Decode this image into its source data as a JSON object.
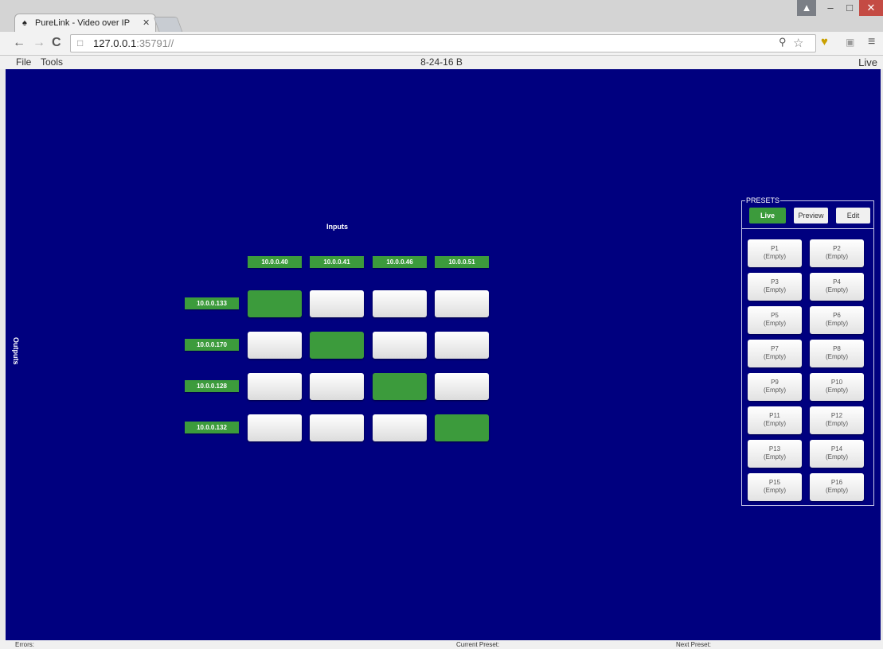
{
  "browser": {
    "tab_title": "PureLink - Video over IP",
    "url_host": "127.0.0.1",
    "url_rest": ":35791//"
  },
  "menubar": {
    "file": "File",
    "tools": "Tools",
    "config_name": "8-24-16 B",
    "mode": "Live"
  },
  "matrix": {
    "inputs_label": "Inputs",
    "outputs_label": "Outputs",
    "inputs": [
      "10.0.0.40",
      "10.0.0.41",
      "10.0.0.46",
      "10.0.0.51"
    ],
    "outputs": [
      "10.0.0.133",
      "10.0.0.170",
      "10.0.0.128",
      "10.0.0.132"
    ],
    "routes": [
      [
        1,
        0,
        0,
        0
      ],
      [
        0,
        1,
        0,
        0
      ],
      [
        0,
        0,
        1,
        0
      ],
      [
        0,
        0,
        0,
        1
      ]
    ]
  },
  "presets": {
    "title": "PRESETS",
    "live": "Live",
    "preview": "Preview",
    "edit": "Edit",
    "items": [
      {
        "name": "P1",
        "state": "(Empty)"
      },
      {
        "name": "P2",
        "state": "(Empty)"
      },
      {
        "name": "P3",
        "state": "(Empty)"
      },
      {
        "name": "P4",
        "state": "(Empty)"
      },
      {
        "name": "P5",
        "state": "(Empty)"
      },
      {
        "name": "P6",
        "state": "(Empty)"
      },
      {
        "name": "P7",
        "state": "(Empty)"
      },
      {
        "name": "P8",
        "state": "(Empty)"
      },
      {
        "name": "P9",
        "state": "(Empty)"
      },
      {
        "name": "P10",
        "state": "(Empty)"
      },
      {
        "name": "P11",
        "state": "(Empty)"
      },
      {
        "name": "P12",
        "state": "(Empty)"
      },
      {
        "name": "P13",
        "state": "(Empty)"
      },
      {
        "name": "P14",
        "state": "(Empty)"
      },
      {
        "name": "P15",
        "state": "(Empty)"
      },
      {
        "name": "P16",
        "state": "(Empty)"
      }
    ]
  },
  "status": {
    "errors": "Errors:",
    "current_preset": "Current Preset:",
    "next_preset": "Next Preset:"
  },
  "colors": {
    "background": "#00007f",
    "active_green": "#3c9b3c"
  }
}
